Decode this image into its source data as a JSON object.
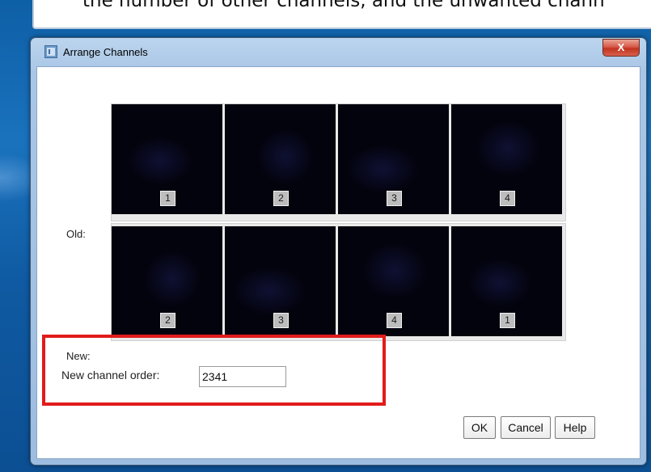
{
  "background": {
    "doc_text": "the number of other channels, and the unwanted chann"
  },
  "window": {
    "title": "Arrange Channels",
    "close_glyph": "X",
    "icon": "java-app-icon"
  },
  "rows": [
    {
      "label": "Old:",
      "channels": [
        "1",
        "2",
        "3",
        "4"
      ]
    },
    {
      "label": "New:",
      "channels": [
        "2",
        "3",
        "4",
        "1"
      ]
    }
  ],
  "order": {
    "label": "New channel order:",
    "value": "2341"
  },
  "buttons": {
    "ok": "OK",
    "cancel": "Cancel",
    "help": "Help"
  },
  "colors": {
    "highlight": "#e21b1b",
    "thumbnail_bg": "#03030e",
    "close_button": "#c2331f"
  }
}
